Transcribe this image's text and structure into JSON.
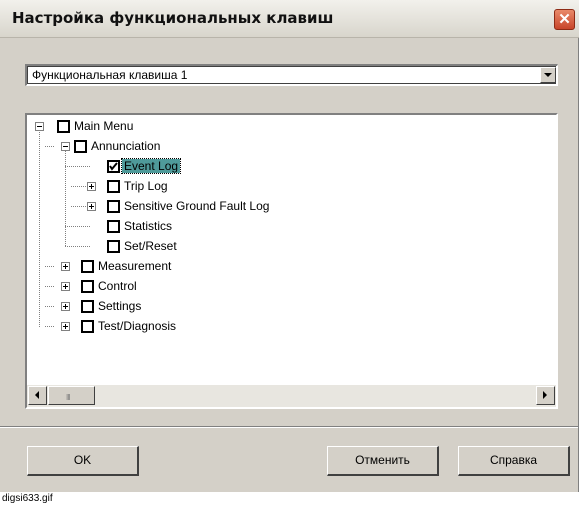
{
  "window": {
    "title": "Настройка функциональных клавиш",
    "close_glyph": "✕"
  },
  "selector": {
    "value": "Функциональная клавиша 1"
  },
  "tree": {
    "root": {
      "label": "Main Menu",
      "checked": false
    },
    "annunciation": {
      "label": "Annunciation",
      "checked": false
    },
    "event_log": {
      "label": "Event Log",
      "checked": true,
      "selected": true
    },
    "trip_log": {
      "label": "Trip Log",
      "checked": false
    },
    "sensitive_ground": {
      "label": "Sensitive Ground Fault Log",
      "checked": false
    },
    "statistics": {
      "label": "Statistics",
      "checked": false
    },
    "set_reset": {
      "label": "Set/Reset",
      "checked": false
    },
    "measurement": {
      "label": "Measurement",
      "checked": false
    },
    "control": {
      "label": "Control",
      "checked": false
    },
    "settings": {
      "label": "Settings",
      "checked": false
    },
    "test_diagnosis": {
      "label": "Test/Diagnosis",
      "checked": false
    }
  },
  "scrollbar": {
    "thumb_grip": "III"
  },
  "buttons": {
    "ok": "OK",
    "cancel": "Отменить",
    "help": "Справка"
  },
  "caption": "digsi633.gif"
}
